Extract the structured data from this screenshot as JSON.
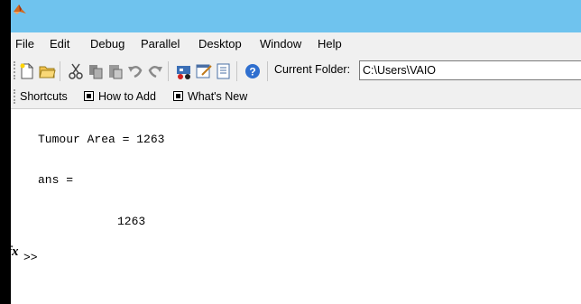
{
  "titlebar": {
    "logo_icon": "matlab-logo-icon",
    "color": "#6fc3ee"
  },
  "menu": [
    "File",
    "Edit",
    "Debug",
    "Parallel",
    "Desktop",
    "Window",
    "Help"
  ],
  "toolbar": {
    "icons": [
      "new-file-icon",
      "open-folder-icon",
      "cut-icon",
      "copy-icon",
      "paste-icon",
      "undo-icon",
      "redo-icon",
      "simulink-icon",
      "guide-icon",
      "profiler-icon",
      "help-icon"
    ],
    "current_folder_label": "Current Folder:",
    "current_folder_value": "C:\\Users\\VAIO"
  },
  "shortcuts": {
    "label": "Shortcuts",
    "how_to_add": "How to Add",
    "whats_new": "What's New"
  },
  "console": {
    "line1": "Tumour Area = 1263",
    "line2": "ans =",
    "line3": "1263",
    "prompt": ">>",
    "fx": "fx"
  }
}
